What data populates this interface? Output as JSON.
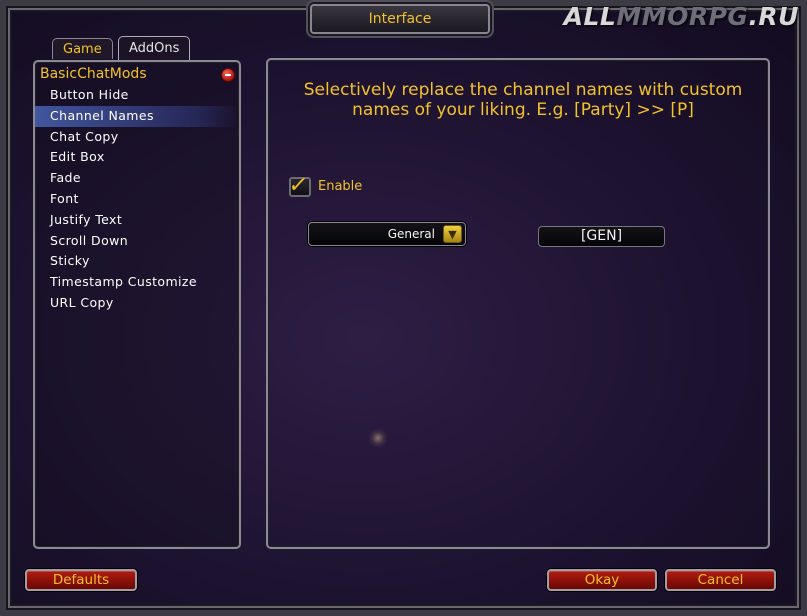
{
  "window": {
    "title": "Interface"
  },
  "logo": {
    "part1": "ALL",
    "part2": "MMORPG",
    "part3": ".RU"
  },
  "tabs": [
    {
      "label": "Game",
      "active": false
    },
    {
      "label": "AddOns",
      "active": true
    }
  ],
  "sidebar": {
    "group": "BasicChatMods",
    "items": [
      {
        "label": "Button Hide"
      },
      {
        "label": "Channel Names",
        "selected": true
      },
      {
        "label": "Chat Copy"
      },
      {
        "label": "Edit Box"
      },
      {
        "label": "Fade"
      },
      {
        "label": "Font"
      },
      {
        "label": "Justify Text"
      },
      {
        "label": "Scroll Down"
      },
      {
        "label": "Sticky"
      },
      {
        "label": "Timestamp Customize"
      },
      {
        "label": "URL Copy"
      }
    ]
  },
  "main": {
    "description": "Selectively replace the channel names with custom names of your liking. E.g. [Party] >> [P]",
    "enable": {
      "label": "Enable",
      "checked": true
    },
    "channel_dropdown": {
      "value": "General"
    },
    "channel_name_input": {
      "value": "[GEN]"
    }
  },
  "buttons": {
    "defaults": "Defaults",
    "okay": "Okay",
    "cancel": "Cancel"
  },
  "colors": {
    "gold_text": "#f2c22a",
    "button_red": "#b21c10",
    "selection_blue": "#506ec8"
  }
}
